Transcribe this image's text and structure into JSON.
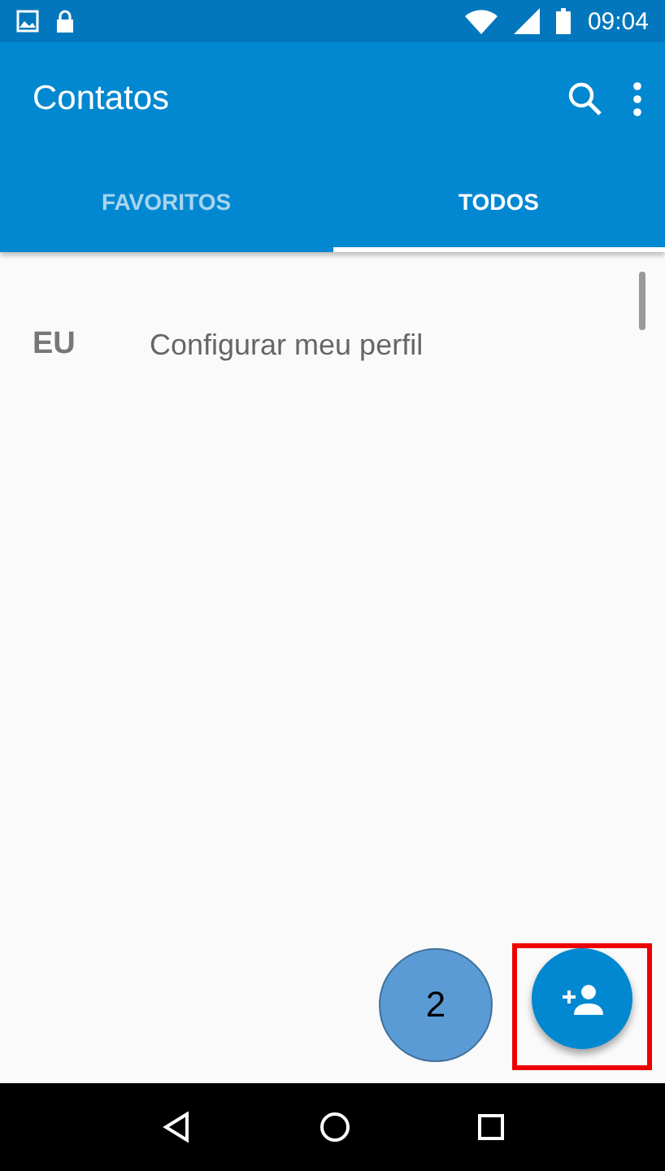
{
  "status_bar": {
    "time": "09:04"
  },
  "app_bar": {
    "title": "Contatos"
  },
  "tabs": [
    {
      "label": "FAVORITOS",
      "selected": false
    },
    {
      "label": "TODOS",
      "selected": true
    }
  ],
  "profile_row": {
    "label": "EU",
    "action": "Configurar meu perfil"
  },
  "annotation": {
    "number": "2"
  }
}
